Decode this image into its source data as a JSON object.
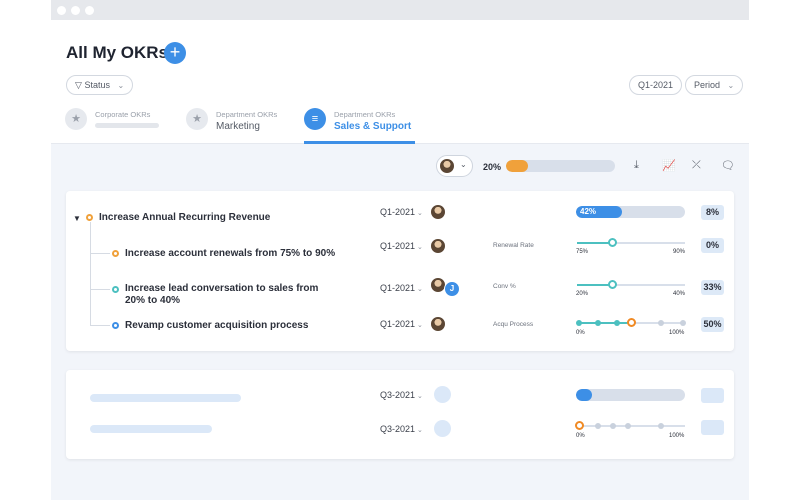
{
  "page": {
    "title": "All My OKRs",
    "add_icon": "plus-icon",
    "add_label": "+"
  },
  "filters": {
    "status_label": "Status",
    "quarter_label": "Q1-2021",
    "period_label": "Period"
  },
  "tabs": [
    {
      "sublabel": "Corporate OKRs",
      "label": "",
      "icon": "star-icon",
      "active": false
    },
    {
      "sublabel": "Department OKRs",
      "label": "Marketing",
      "icon": "star-icon",
      "active": false
    },
    {
      "sublabel": "Department OKRs",
      "label": "Sales & Support",
      "icon": "document-icon",
      "active": true
    }
  ],
  "toolbar": {
    "overall_progress_label": "20%",
    "overall_progress": 0.2,
    "icons": [
      "download-icon",
      "chart-icon",
      "collapse-icon",
      "comment-icon"
    ]
  },
  "objective": {
    "title": "Increase Annual Recurring Revenue",
    "period": "Q1-2021",
    "progress_label": "42%",
    "progress": 0.42,
    "score": "8%",
    "key_results": [
      {
        "title": "Increase account renewals from 75% to 90%",
        "period": "Q1-2021",
        "metric": "Renewal Rate",
        "start_label": "75%",
        "end_label": "90%",
        "progress": 0.33,
        "score": "0%"
      },
      {
        "title_line1": "Increase lead conversation to sales from",
        "title_line2": "20% to 40%",
        "period": "Q1-2021",
        "metric": "Conv %",
        "start_label": "20%",
        "end_label": "40%",
        "progress": 0.33,
        "score": "33%",
        "owner_initial": "J"
      },
      {
        "title": "Revamp customer acquisition process",
        "period": "Q1-2021",
        "metric": "Acqu Process",
        "start_label": "0%",
        "end_label": "100%",
        "progress": 0.5,
        "score": "50%"
      }
    ]
  },
  "placeholder_rows": [
    {
      "period": "Q3-2021",
      "progress": 0.15
    },
    {
      "period": "Q3-2021",
      "start_label": "0%",
      "end_label": "100%"
    }
  ],
  "colors": {
    "accent": "#3d8fe6",
    "orange": "#f0a13b",
    "teal": "#4cc0c0"
  }
}
